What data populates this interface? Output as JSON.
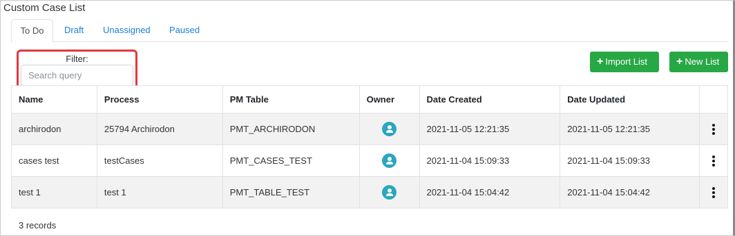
{
  "window": {
    "title": "Custom Case List"
  },
  "tabs": [
    {
      "label": "To Do",
      "active": true
    },
    {
      "label": "Draft",
      "active": false
    },
    {
      "label": "Unassigned",
      "active": false
    },
    {
      "label": "Paused",
      "active": false
    }
  ],
  "filter": {
    "label": "Filter:",
    "placeholder": "Search query",
    "value": ""
  },
  "toolbar": {
    "import_label": "Import List",
    "new_label": "New List",
    "button_color": "#28a745"
  },
  "table": {
    "headers": [
      "Name",
      "Process",
      "PM Table",
      "Owner",
      "Date Created",
      "Date Updated",
      ""
    ],
    "rows": [
      {
        "name": "archirodon",
        "process": "25794 Archirodon",
        "pm_table": "PMT_ARCHIRODON",
        "owner_icon": "user-avatar-icon",
        "date_created": "2021-11-05 12:21:35",
        "date_updated": "2021-11-05 12:21:35"
      },
      {
        "name": "cases test",
        "process": "testCases",
        "pm_table": "PMT_CASES_TEST",
        "owner_icon": "user-avatar-icon",
        "date_created": "2021-11-04 15:09:33",
        "date_updated": "2021-11-04 15:09:33"
      },
      {
        "name": "test 1",
        "process": "test 1",
        "pm_table": "PMT_TABLE_TEST",
        "owner_icon": "user-avatar-icon",
        "date_created": "2021-11-04 15:04:42",
        "date_updated": "2021-11-04 15:04:42"
      }
    ]
  },
  "footer": {
    "records": "3 records"
  },
  "colors": {
    "accent": "#1a7fd4",
    "highlight": "#e0383e",
    "avatar": "#2aa6bf"
  }
}
